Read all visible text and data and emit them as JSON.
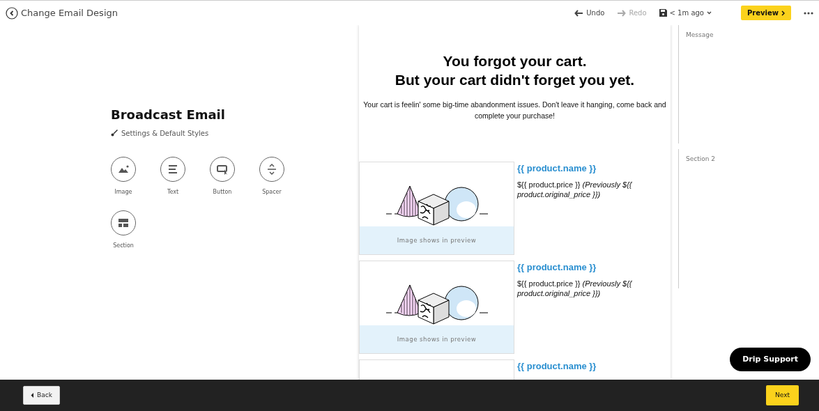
{
  "header": {
    "back_label": "Change Email Design",
    "undo": {
      "label": "Undo",
      "disabled": false
    },
    "redo": {
      "label": "Redo",
      "disabled": true
    },
    "saved": "< 1m ago",
    "preview": "Preview"
  },
  "panel": {
    "title": "Broadcast Email",
    "settings": "Settings & Default Styles",
    "blocks": [
      {
        "label": "Image",
        "kind": "image"
      },
      {
        "label": "Text",
        "kind": "text"
      },
      {
        "label": "Button",
        "kind": "button"
      },
      {
        "label": "Spacer",
        "kind": "spacer"
      },
      {
        "label": "Section",
        "kind": "section"
      }
    ]
  },
  "email": {
    "heading": [
      "You forgot your cart.",
      "But your cart didn't forget you yet."
    ],
    "body": "Your cart is feelin' some big-time abandonment issues. Don't leave it hanging, come back and complete your purchase!",
    "products": [
      {
        "name": "{{ product.name }}",
        "price": "${{ product.price }} *(Previously ${{ product.original_price }})*",
        "image_caption": "Image shows in preview"
      },
      {
        "name": "{{ product.name }}",
        "price": "${{ product.price }} *(Previously ${{ product.original_price }})*",
        "image_caption": "Image shows in preview"
      },
      {
        "name": "{{ product.name }}"
      }
    ]
  },
  "outline": [
    "Message",
    "Section 2"
  ],
  "support": "Drip Support",
  "footer": {
    "back": "Back",
    "next": "Next"
  }
}
